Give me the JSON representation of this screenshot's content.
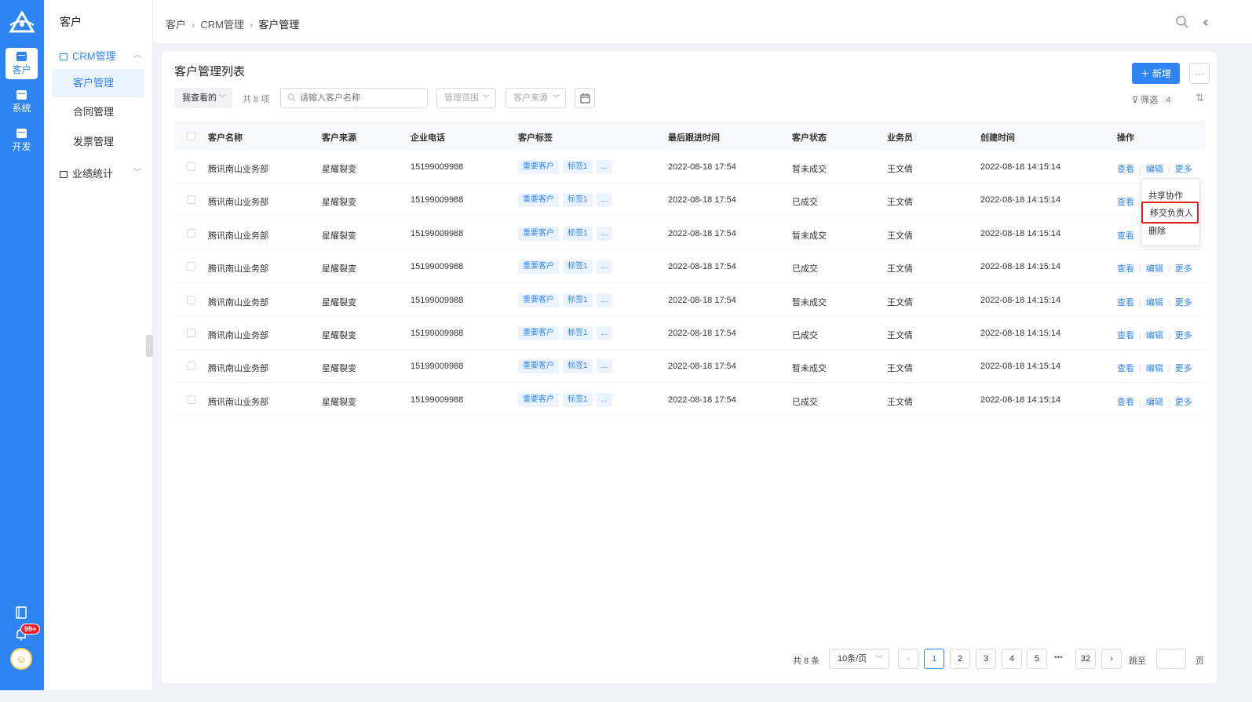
{
  "rail": {
    "items": [
      {
        "label": "客户",
        "active": true
      },
      {
        "label": "系统",
        "active": false
      },
      {
        "label": "开发",
        "active": false
      }
    ],
    "badge": "99+"
  },
  "sidebar": {
    "title": "客户",
    "groups": [
      {
        "label": "CRM管理",
        "open": true,
        "items": [
          "客户管理",
          "合同管理",
          "发票管理"
        ]
      },
      {
        "label": "业绩统计",
        "open": false
      }
    ]
  },
  "breadcrumb": [
    "客户",
    "CRM管理",
    "客户管理"
  ],
  "page": {
    "title": "客户管理列表",
    "add_label": "新增",
    "more_label": "···",
    "filter_mine": "我查看的",
    "count_text": "共 8 项",
    "search_placeholder": "请输入客户名称",
    "filter_scope": "管理范围",
    "filter_source": "客户来源",
    "filter_label": "筛选",
    "filter_count": "4"
  },
  "table": {
    "columns": [
      "客户名称",
      "客户来源",
      "企业电话",
      "客户标签",
      "最后跟进时间",
      "客户状态",
      "业务员",
      "创建时间",
      "操作"
    ],
    "rows": [
      {
        "name": "腾讯南山业务部",
        "source": "星耀裂变",
        "phone": "15199009988",
        "tags": [
          "重要客户",
          "标签1",
          "..."
        ],
        "last_follow": "2022-08-18 17:54",
        "status": "暂未成交",
        "sales": "王文倩",
        "created": "2022-08-18 14:15:14"
      },
      {
        "name": "腾讯南山业务部",
        "source": "星耀裂变",
        "phone": "15199009988",
        "tags": [
          "重要客户",
          "标签1",
          "..."
        ],
        "last_follow": "2022-08-18 17:54",
        "status": "已成交",
        "sales": "王文倩",
        "created": "2022-08-18 14:15:14"
      },
      {
        "name": "腾讯南山业务部",
        "source": "星耀裂变",
        "phone": "15199009988",
        "tags": [
          "重要客户",
          "标签1",
          "..."
        ],
        "last_follow": "2022-08-18 17:54",
        "status": "暂未成交",
        "sales": "王文倩",
        "created": "2022-08-18 14:15:14"
      },
      {
        "name": "腾讯南山业务部",
        "source": "星耀裂变",
        "phone": "15199009988",
        "tags": [
          "重要客户",
          "标签1",
          "..."
        ],
        "last_follow": "2022-08-18 17:54",
        "status": "已成交",
        "sales": "王文倩",
        "created": "2022-08-18 14:15:14"
      },
      {
        "name": "腾讯南山业务部",
        "source": "星耀裂变",
        "phone": "15199009988",
        "tags": [
          "重要客户",
          "标签1",
          "..."
        ],
        "last_follow": "2022-08-18 17:54",
        "status": "暂未成交",
        "sales": "王文倩",
        "created": "2022-08-18 14:15:14"
      },
      {
        "name": "腾讯南山业务部",
        "source": "星耀裂变",
        "phone": "15199009988",
        "tags": [
          "重要客户",
          "标签1",
          "..."
        ],
        "last_follow": "2022-08-18 17:54",
        "status": "已成交",
        "sales": "王文倩",
        "created": "2022-08-18 14:15:14"
      },
      {
        "name": "腾讯南山业务部",
        "source": "星耀裂变",
        "phone": "15199009988",
        "tags": [
          "重要客户",
          "标签1",
          "..."
        ],
        "last_follow": "2022-08-18 17:54",
        "status": "暂未成交",
        "sales": "王文倩",
        "created": "2022-08-18 14:15:14"
      },
      {
        "name": "腾讯南山业务部",
        "source": "星耀裂变",
        "phone": "15199009988",
        "tags": [
          "重要客户",
          "标签1",
          "..."
        ],
        "last_follow": "2022-08-18 17:54",
        "status": "已成交",
        "sales": "王文倩",
        "created": "2022-08-18 14:15:14"
      }
    ],
    "actions": [
      "查看",
      "编辑",
      "更多"
    ]
  },
  "popover": {
    "items": [
      "共享协作",
      "移交负责人",
      "删除"
    ],
    "highlighted": "移交负责人"
  },
  "pagination": {
    "total_text": "共 8 条",
    "page_size": "10条/页",
    "pages": [
      "1",
      "2",
      "3",
      "4",
      "5"
    ],
    "current": "1",
    "ellipsis": "•••",
    "last_page": "32",
    "prev": "‹",
    "next": "›",
    "jump_label": "跳至",
    "page_unit": "页"
  },
  "colors": {
    "brand": "#2f84f3",
    "highlight_border": "#e02020"
  },
  "icons": [
    "logo-icon",
    "customer-icon",
    "system-icon",
    "dev-icon",
    "book-icon",
    "bell-icon",
    "search-icon",
    "collapse-icon",
    "calendar-icon",
    "filter-icon",
    "sort-icon"
  ]
}
